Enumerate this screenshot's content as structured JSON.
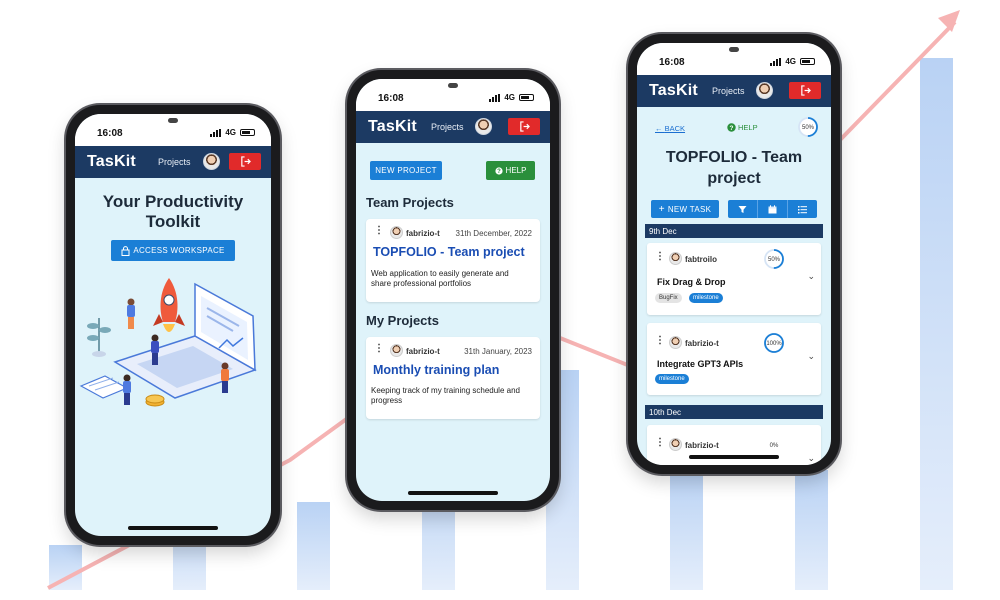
{
  "app": {
    "brand": "TasKit",
    "nav_projects": "Projects"
  },
  "status": {
    "time": "16:08",
    "network": "4G"
  },
  "colors": {
    "appbar": "#1c3a63",
    "primary": "#1b7fd6",
    "success": "#2a8f3b",
    "danger": "#e12a2a",
    "screen_bg": "#dff3fa",
    "link": "#1a4db3",
    "trend_line": "#f6a3a3",
    "bars": "#c9dcf5"
  },
  "icons": {
    "logout": "logout-icon",
    "lock": "lock-icon",
    "help": "help-circle-icon",
    "filter": "filter-icon",
    "calendar": "calendar-icon",
    "list": "list-icon",
    "plus": "plus-icon",
    "back": "arrow-left-icon",
    "kebab": "kebab-menu-icon",
    "chevron": "chevron-down-icon"
  },
  "home": {
    "title_line1": "Your Productivity",
    "title_line2": "Toolkit",
    "access_button": "ACCESS WORKSPACE"
  },
  "projects_page": {
    "new_project_button": "NEW PROJECT",
    "help_button": "HELP",
    "team_heading": "Team Projects",
    "my_heading": "My Projects",
    "team_projects": [
      {
        "author": "fabrizio-t",
        "date": "31th December, 2022",
        "title": "TOPFOLIO - Team project",
        "description_line1": "Web application to easily generate and",
        "description_line2": "share professional portfolios"
      }
    ],
    "my_projects": [
      {
        "author": "fabrizio-t",
        "date": "31th January, 2023",
        "title": "Monthly training plan",
        "description_line1": "Keeping track of my training schedule and",
        "description_line2": "progress"
      }
    ]
  },
  "project_detail": {
    "back_label": "BACK",
    "help_label": "HELP",
    "progress_label": "50%",
    "progress": 0.5,
    "title_line1": "TOPFOLIO - Team",
    "title_line2": "project",
    "new_task_button": "NEW TASK",
    "groups": [
      {
        "day": "9th Dec",
        "tasks": [
          {
            "author": "fabtroilo",
            "title": "Fix Drag & Drop",
            "progress_label": "50%",
            "progress": 0.5,
            "tags": [
              "BugFix",
              "milestone"
            ]
          },
          {
            "author": "fabrizio-t",
            "title": "Integrate GPT3 APIs",
            "progress_label": "100%",
            "progress": 1.0,
            "tags": [
              "milestone"
            ]
          }
        ]
      },
      {
        "day": "10th Dec",
        "tasks": [
          {
            "author": "fabrizio-t",
            "title": "",
            "progress_label": "0%",
            "progress": 0.0,
            "tags": []
          }
        ]
      }
    ]
  }
}
